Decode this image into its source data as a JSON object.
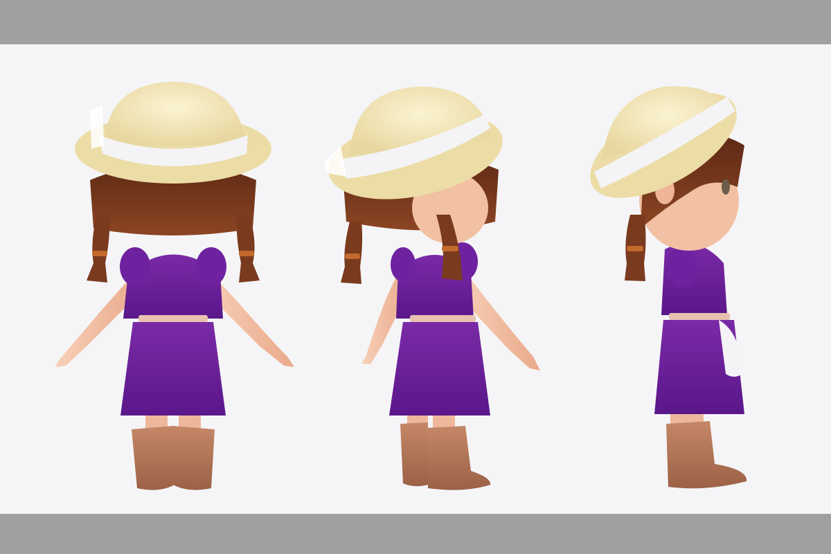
{
  "image": {
    "kind": "character-turnaround",
    "views": [
      "back",
      "three-quarter-back",
      "side"
    ]
  },
  "colors": {
    "frame": "#a0a0a0",
    "background": "#f5f5f7",
    "dress": "#6b1f96",
    "dress_shade": "#4a1170",
    "hat": "#f3e6b8",
    "hat_band": "#f4f4f6",
    "hair": "#7a3a1e",
    "skin": "#f4c3a6",
    "belt": "#e8c1b0",
    "boots": "#b97a5a",
    "hair_tie": "#c26a2c"
  }
}
